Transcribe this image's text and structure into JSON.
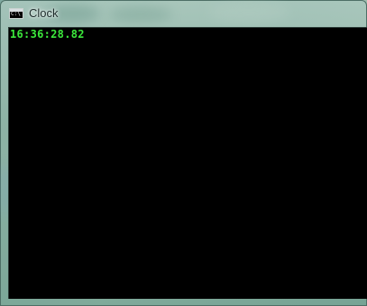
{
  "window": {
    "title": "Clock",
    "icon": "console-icon",
    "icon_glyph": "C:\\"
  },
  "console": {
    "lines": [
      "16:36:28.82"
    ],
    "text_color": "#3ce83c",
    "background": "#000000"
  }
}
